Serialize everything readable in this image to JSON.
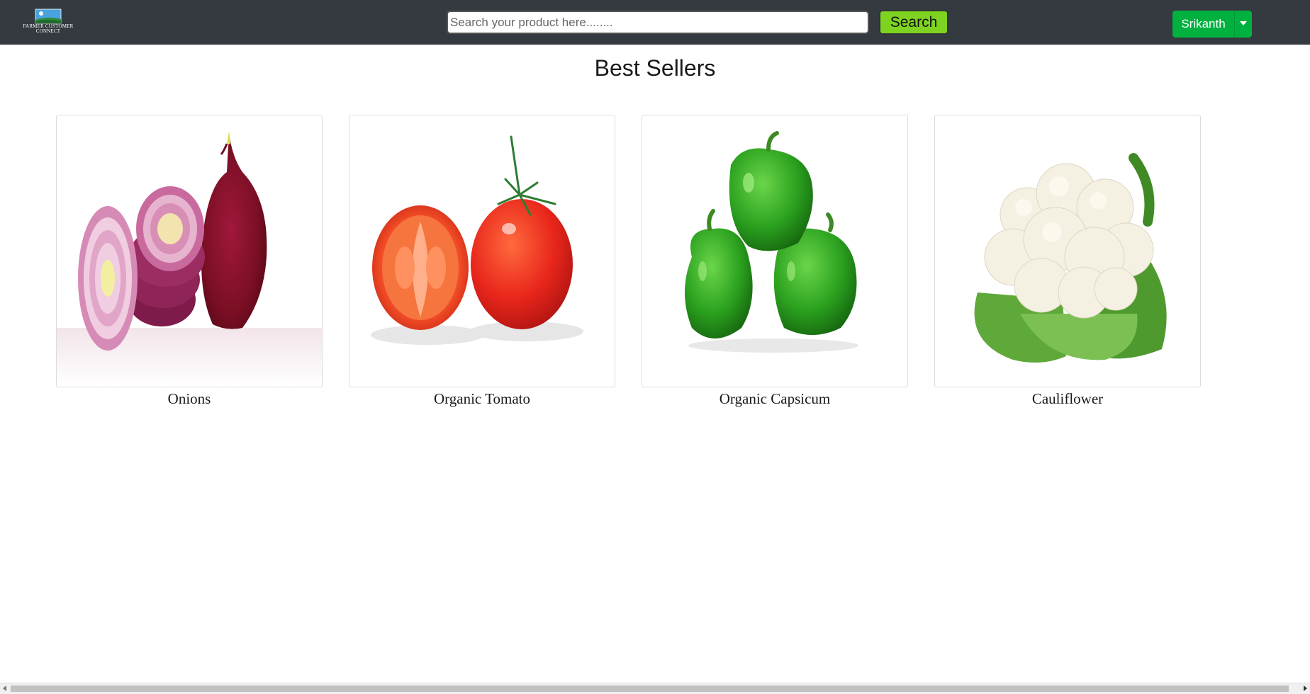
{
  "header": {
    "logo_text": "FARMER CUSTOMER CONNECT",
    "search_placeholder": "Search your product here........",
    "search_label": "Search",
    "user_name": "Srikanth"
  },
  "main": {
    "title": "Best Sellers",
    "products": [
      {
        "name": "Onions",
        "icon": "onion-image"
      },
      {
        "name": "Organic Tomato",
        "icon": "tomato-image"
      },
      {
        "name": "Organic Capsicum",
        "icon": "capsicum-image"
      },
      {
        "name": "Cauliflower",
        "icon": "cauliflower-image"
      }
    ]
  },
  "colors": {
    "navbar": "#343a40",
    "search_button": "#7ed321",
    "user_button": "#00b140"
  }
}
